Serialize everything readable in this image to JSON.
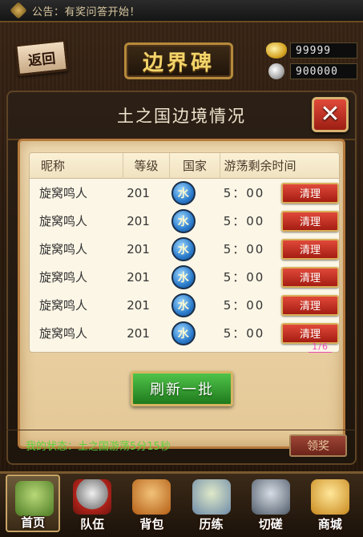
{
  "announcement": {
    "text": "公告：有奖问答开始！"
  },
  "header": {
    "back_label": "返回",
    "title": "边界碑",
    "gold": "99999",
    "silver": "900000"
  },
  "panel": {
    "title": "土之国边境情况",
    "columns": {
      "name": "昵称",
      "level": "等级",
      "country": "国家",
      "time": "游荡剩余时间"
    },
    "rows": [
      {
        "name": "旋窝鸣人",
        "level": "201",
        "country": "水",
        "time": "5：00",
        "action": "清理"
      },
      {
        "name": "旋窝鸣人",
        "level": "201",
        "country": "水",
        "time": "5：00",
        "action": "清理"
      },
      {
        "name": "旋窝鸣人",
        "level": "201",
        "country": "水",
        "time": "5：00",
        "action": "清理"
      },
      {
        "name": "旋窝鸣人",
        "level": "201",
        "country": "水",
        "time": "5：00",
        "action": "清理"
      },
      {
        "name": "旋窝鸣人",
        "level": "201",
        "country": "水",
        "time": "5：00",
        "action": "清理"
      },
      {
        "name": "旋窝鸣人",
        "level": "201",
        "country": "水",
        "time": "5：00",
        "action": "清理"
      }
    ],
    "page_indicator": "1/6",
    "refresh_label": "刷新一批"
  },
  "status": {
    "text": "我的状态：土之国游荡5分15秒",
    "claim_label": "领奖"
  },
  "nav": [
    {
      "label": "首页",
      "icon": "house-icon",
      "color": "#7fb24a"
    },
    {
      "label": "队伍",
      "icon": "headband-icon",
      "color": "#c8c8c8"
    },
    {
      "label": "背包",
      "icon": "scroll-bag-icon",
      "color": "#d68a2a"
    },
    {
      "label": "历练",
      "icon": "map-scroll-icon",
      "color": "#9fb8d6"
    },
    {
      "label": "切磋",
      "icon": "kunai-icon",
      "color": "#8c98a8"
    },
    {
      "label": "商城",
      "icon": "lucky-cat-icon",
      "color": "#e0b03a"
    }
  ]
}
